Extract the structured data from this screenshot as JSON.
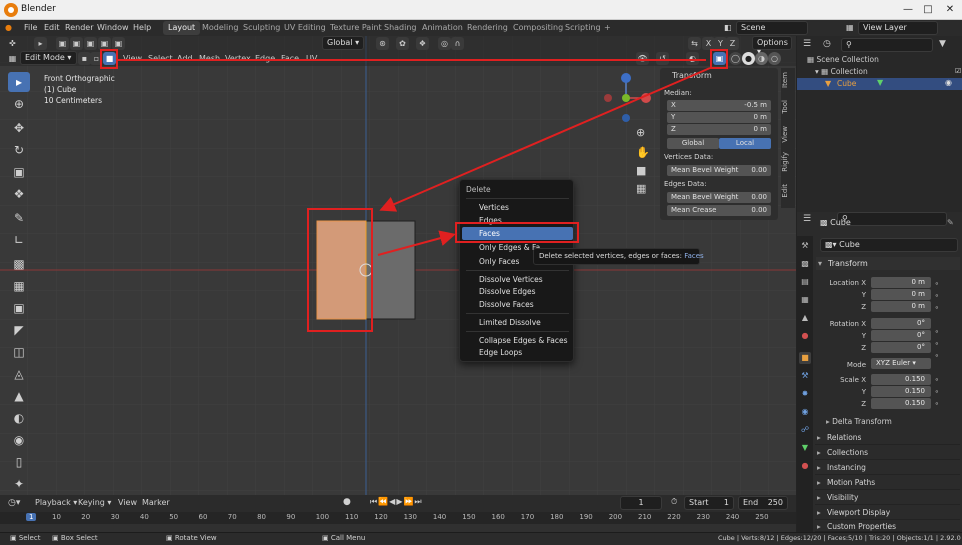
{
  "window": {
    "title": "Blender"
  },
  "menubar": {
    "items": [
      "File",
      "Edit",
      "Render",
      "Window",
      "Help"
    ],
    "workspaces": [
      "Layout",
      "Modeling",
      "Sculpting",
      "UV Editing",
      "Texture Paint",
      "Shading",
      "Animation",
      "Rendering",
      "Compositing",
      "Scripting"
    ],
    "add_tab": "+",
    "scene": "Scene",
    "view_layer": "View Layer"
  },
  "header": {
    "orientation": "Global",
    "options": "Options",
    "mode": "Edit Mode",
    "menus": [
      "View",
      "Select",
      "Add",
      "Mesh",
      "Vertex",
      "Edge",
      "Face",
      "UV"
    ],
    "axes": [
      "X",
      "Y",
      "Z"
    ]
  },
  "overlay": {
    "line1": "Front Orthographic",
    "line2": "(1) Cube",
    "line3": "10 Centimeters"
  },
  "npanel": {
    "title": "Transform",
    "median": "Median:",
    "rows": [
      {
        "label": "X",
        "value": "-0.5 m"
      },
      {
        "label": "Y",
        "value": "0 m"
      },
      {
        "label": "Z",
        "value": "0 m"
      }
    ],
    "global": "Global",
    "local": "Local",
    "vertices_data": "Vertices Data:",
    "mean_bevel_v": "Mean Bevel Weight",
    "mean_bevel_v_val": "0.00",
    "edges_data": "Edges Data:",
    "mean_bevel_e": "Mean Bevel Weight",
    "mean_bevel_e_val": "0.00",
    "mean_crease": "Mean Crease",
    "mean_crease_val": "0.00"
  },
  "sidetabs": [
    "Item",
    "Tool",
    "View",
    "Rigify",
    "Edit"
  ],
  "context_menu": {
    "title": "Delete",
    "items": [
      "Vertices",
      "Edges",
      "Faces",
      "Only Edges & Fa...",
      "Only Faces",
      "Dissolve Vertices",
      "Dissolve Edges",
      "Dissolve Faces",
      "Limited Dissolve",
      "Collapse Edges & Faces",
      "Edge Loops"
    ],
    "highlighted": "Faces"
  },
  "tooltip": {
    "text": "Delete selected vertices, edges or faces:",
    "value": "Faces"
  },
  "outliner": {
    "scene_collection": "Scene Collection",
    "collection": "Collection",
    "object": "Cube"
  },
  "properties": {
    "object_name": "Cube",
    "data_name": "Cube",
    "transform": "Transform",
    "location_x": "Location X",
    "y": "Y",
    "z": "Z",
    "rotation_x": "Rotation X",
    "mode": "Mode",
    "mode_value": "XYZ Euler",
    "scale_x": "Scale X",
    "loc": [
      "0 m",
      "0 m",
      "0 m"
    ],
    "rot": [
      "0°",
      "0°",
      "0°"
    ],
    "scale": [
      "0.150",
      "0.150",
      "0.150"
    ],
    "delta": "Delta Transform",
    "sections": [
      "Relations",
      "Collections",
      "Instancing",
      "Motion Paths",
      "Visibility",
      "Viewport Display",
      "Custom Properties"
    ]
  },
  "timeline": {
    "menus": [
      "Playback",
      "Keying",
      "View",
      "Marker"
    ],
    "current": "1",
    "start_label": "Start",
    "start": "1",
    "end_label": "End",
    "end": "250",
    "ticks": [
      "1",
      "10",
      "20",
      "30",
      "40",
      "50",
      "60",
      "70",
      "80",
      "90",
      "100",
      "110",
      "120",
      "130",
      "140",
      "150",
      "160",
      "170",
      "180",
      "190",
      "200",
      "210",
      "220",
      "230",
      "240",
      "250"
    ]
  },
  "statusbar": {
    "select": "Select",
    "box_select": "Box Select",
    "rotate_view": "Rotate View",
    "call_menu": "Call Menu",
    "stats": "Cube | Verts:8/12 | Edges:12/20 | Faces:5/10 | Tris:20 | Objects:1/1 | 2.92.0"
  },
  "colors": {
    "accent": "#4772b3",
    "selected_face": "#d39a78",
    "annotation": "#e02020"
  }
}
